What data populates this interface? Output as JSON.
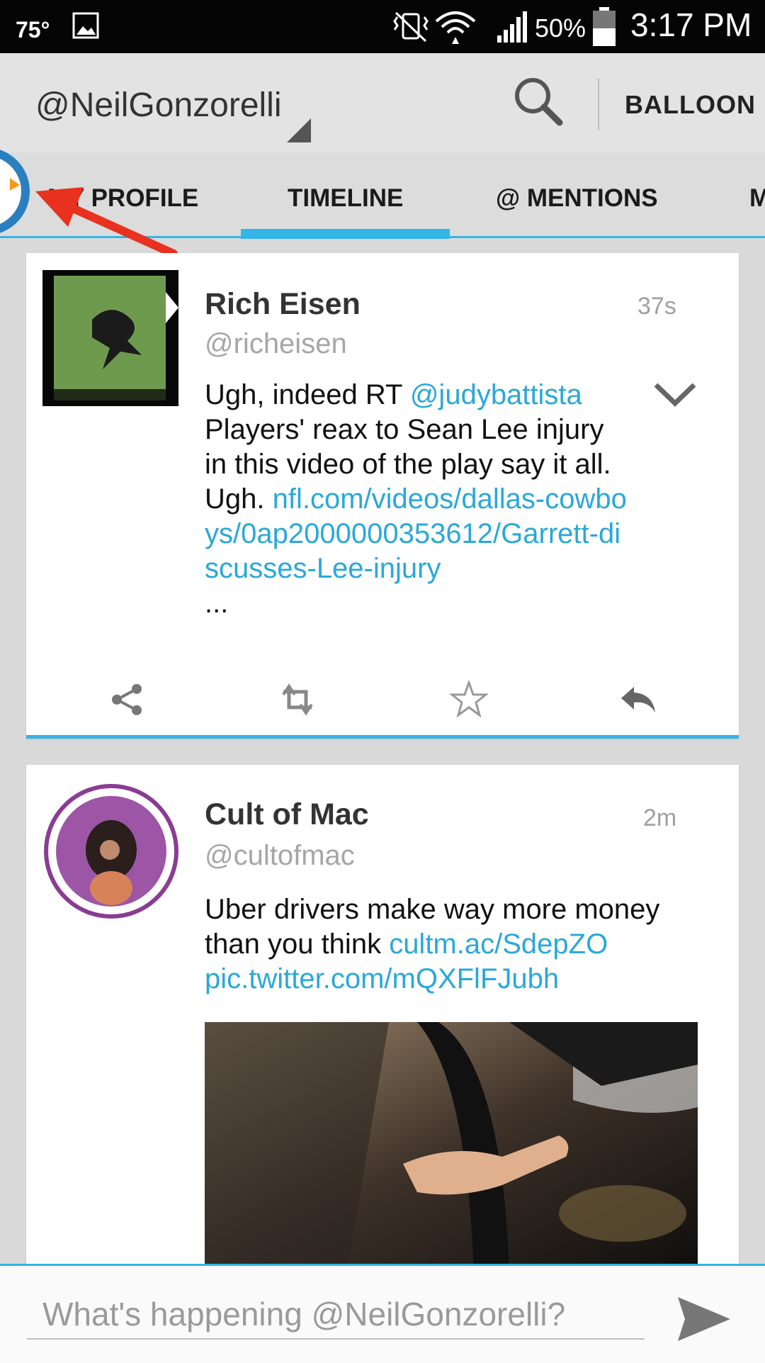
{
  "status_bar": {
    "temperature": "75°",
    "battery": "50%",
    "time": "3:17 PM"
  },
  "action_bar": {
    "account": "@NeilGonzorelli",
    "right_button": "BALLOON",
    "icons": [
      "search-icon"
    ]
  },
  "tabs": [
    {
      "label": "MY PROFILE",
      "active": false
    },
    {
      "label": "TIMELINE",
      "active": true
    },
    {
      "label": "@ MENTIONS",
      "active": false
    },
    {
      "label": "M",
      "active": false
    }
  ],
  "tweets": [
    {
      "name": "Rich Eisen",
      "handle": "@richeisen",
      "time": "37s",
      "text_1": "Ugh, indeed RT ",
      "link_1": "@judybattista",
      "text_2": "Players' reax to Sean Lee injury in this video of the play say it all. Ugh. ",
      "link_2": "nfl.com/videos/dallas-cowboys/0ap2000000353612/Garrett-discusses-Lee-injury",
      "text_3": "...",
      "actions": [
        "share-icon",
        "retweet-icon",
        "favorite-icon",
        "reply-icon"
      ]
    },
    {
      "name": "Cult of Mac",
      "handle": "@cultofmac",
      "time": "2m",
      "text_1": "Uber drivers make way more money than you think ",
      "link_1": "cultm.ac/SdepZO",
      "link_2": "pic.twitter.com/mQXFlFJubh"
    }
  ],
  "compose": {
    "placeholder": "What's happening @NeilGonzorelli?"
  },
  "colors": {
    "accent": "#33b5e5",
    "link": "#2aa8d8",
    "annotation_arrow": "#e8321f"
  }
}
